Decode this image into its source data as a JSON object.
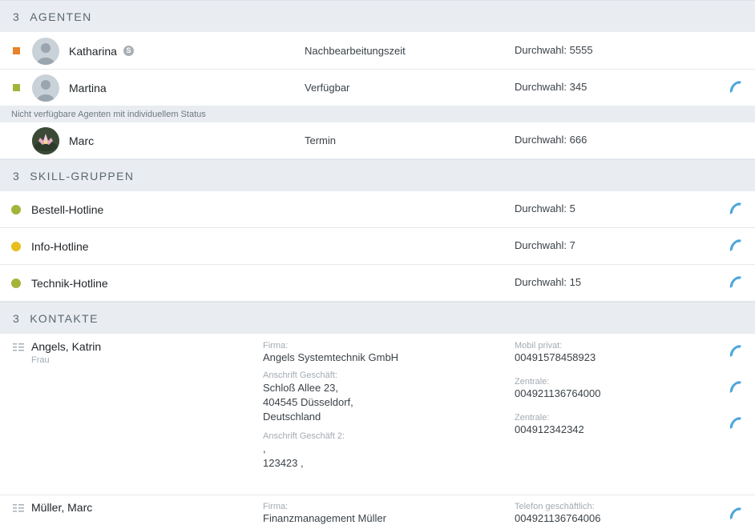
{
  "agents": {
    "count": "3",
    "title": "AGENTEN",
    "rows": [
      {
        "name": "Katharina",
        "badge": "S",
        "status": "Nachbearbeitungszeit",
        "extension": "Durchwahl: 5555",
        "status_color": "#e8832a",
        "callable": false
      },
      {
        "name": "Martina",
        "badge": "",
        "status": "Verfügbar",
        "extension": "Durchwahl: 345",
        "status_color": "#a4b43a",
        "callable": true
      }
    ],
    "unavailable_label": "Nicht verfügbare Agenten mit individuellem Status",
    "unavailable_rows": [
      {
        "name": "Marc",
        "status": "Termin",
        "extension": "Durchwahl: 666"
      }
    ]
  },
  "skill_groups": {
    "count": "3",
    "title": "SKILL-GRUPPEN",
    "rows": [
      {
        "name": "Bestell-Hotline",
        "extension": "Durchwahl: 5",
        "status_color": "#a4b43a"
      },
      {
        "name": "Info-Hotline",
        "extension": "Durchwahl: 7",
        "status_color": "#e6be1e"
      },
      {
        "name": "Technik-Hotline",
        "extension": "Durchwahl: 15",
        "status_color": "#a4b43a"
      }
    ]
  },
  "contacts": {
    "count": "3",
    "title": "KONTAKTE",
    "items": [
      {
        "name": "Angels, Katrin",
        "salutation": "Frau",
        "company_label": "Firma:",
        "company": "Angels Systemtechnik GmbH",
        "address_label": "Anschrift Geschäft:",
        "address": "Schloß Allee 23,\n404545 Düsseldorf,\nDeutschland",
        "address2_label": "Anschrift Geschäft 2:",
        "address2": ",\n123423 ,",
        "phones": [
          {
            "label": "Mobil privat:",
            "number": "00491578458923"
          },
          {
            "label": "Zentrale:",
            "number": "004921136764000"
          },
          {
            "label": "Zentrale:",
            "number": "004912342342"
          }
        ]
      },
      {
        "name": "Müller, Marc",
        "company_label": "Firma:",
        "company": "Finanzmanagement Müller",
        "phones": [
          {
            "label": "Telefon geschäftlich:",
            "number": "004921136764006"
          }
        ]
      }
    ]
  },
  "colors": {
    "phone_icon": "#4ea6dc",
    "section_bg": "#e9edf1"
  },
  "icons": {
    "phone": "phone-icon",
    "contact": "contact-card-icon",
    "avatar": "person-avatar-icon"
  }
}
